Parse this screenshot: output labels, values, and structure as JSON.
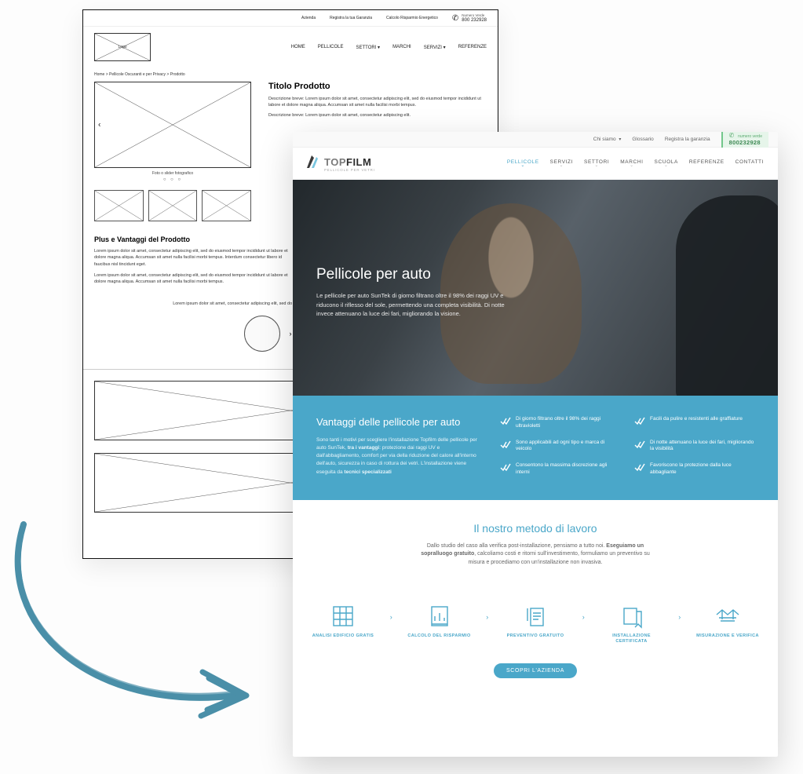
{
  "wireframe": {
    "topbar": {
      "items": [
        "Azienda",
        "Registra la tua Garanzia",
        "Calcolo Risparmio Energetico"
      ],
      "phone_label": "Numero Verde",
      "phone": "800 232928"
    },
    "logo_text": "Logo",
    "nav": [
      "HOME",
      "PELLICOLE",
      "SETTORI ▾",
      "MARCHI",
      "SERVIZI ▾",
      "REFERENZE"
    ],
    "breadcrumbs": "Home > Pellicole Oscuranti e per Privacy > Prodotto",
    "slider_caption": "Foto o slider fotografico",
    "product": {
      "title": "Titolo Prodotto",
      "p1": "Descrizione breve: Lorem ipsum dolor sit amet, consectetur adipiscing elit, sed do eiusmod tempor incididunt ut labore et dolore magna aliqua. Accumsan sit amet nulla facilisi morbi tempus.",
      "p2": "Descrizione breve: Lorem ipsum dolor sit amet, consectetur adipiscing elit."
    },
    "plus": {
      "title": "Plus e Vantaggi del Prodotto",
      "p1": "Lorem ipsum dolor sit amet, consectetur adipiscing elit, sed do eiusmod tempor incididunt ut labore et dolore magna aliqua. Accumsan sit amet nulla facilisi morbi tempus. Interdum consectetur libero id faucibus nisl tincidunt eget.",
      "p2": "Lorem ipsum dolor sit amet, consectetur adipiscing elit, sed do eiusmod tempor incididunt ut labore et dolore magna aliqua. Accumsan sit amet nulla facilisi morbi tempus."
    },
    "feelings_text": "Lorem ipsum dolor sit amet, consectetur adipiscing elit, sed do eiusmod tempor incididunt ut labore et dolore magna aliqua."
  },
  "mockup": {
    "topbar": {
      "items": [
        "Chi siamo",
        "Glossario",
        "Registra la garanzia"
      ],
      "verde_label": "numero verde",
      "verde_number": "800232928"
    },
    "logo": {
      "part1": "TOP",
      "part2": "FILM",
      "tagline": "PELLICOLE PER VETRI"
    },
    "nav": [
      {
        "label": "PELLICOLE",
        "active": true,
        "dropdown": true
      },
      {
        "label": "SERVIZI",
        "active": false,
        "dropdown": true
      },
      {
        "label": "SETTORI",
        "active": false,
        "dropdown": true
      },
      {
        "label": "MARCHI",
        "active": false,
        "dropdown": true
      },
      {
        "label": "SCUOLA",
        "active": false,
        "dropdown": true
      },
      {
        "label": "REFERENZE",
        "active": false,
        "dropdown": false
      },
      {
        "label": "CONTATTI",
        "active": false,
        "dropdown": false
      }
    ],
    "hero": {
      "title": "Pellicole per auto",
      "text": "Le pellicole per auto SunTek di giorno filtrano oltre il 98% dei raggi UV e riducono il riflesso del sole, permettendo una completa visibilità. Di notte invece attenuano la luce dei fari, migliorando la visione."
    },
    "blueband": {
      "title": "Vantaggi delle pellicole per auto",
      "text_a": "Sono tanti i motivi per scegliere l'installazione Topfilm delle pellicole per auto SunTek, ",
      "text_bold1": "tra i vantaggi",
      "text_b": ": protezione dai raggi UV e dall'abbagliamento, comfort per via della riduzione del calore all'interno dell'auto, sicurezza in caso di rottura dei vetri. L'installazione viene eseguita da ",
      "text_bold2": "tecnici specializzati",
      "advantages": [
        "Di giorno filtrano oltre il 98% dei raggi ultravioletti",
        "Facili da pulire e resistenti alle graffiature",
        "Sono applicabili ad ogni tipo e marca di veicolo",
        "Di notte attenuano la luce dei fari, migliorando la visibilità",
        "Consentono la massima discrezione agli interni",
        "Favoriscono la protezione dalla luce abbagliante"
      ]
    },
    "method": {
      "title": "Il nostro metodo di lavoro",
      "text_a": "Dallo studio del caso alla verifica post-installazione, pensiamo a tutto noi. ",
      "text_bold": "Eseguiamo un sopralluogo gratuito",
      "text_b": ", calcoliamo costi e ritorni sull'investimento, formuliamo un preventivo su misura e procediamo con un'installazione non invasiva.",
      "steps": [
        "ANALISI EDIFICIO GRATIS",
        "CALCOLO DEL RISPARMIO",
        "PREVENTIVO GRATUITO",
        "INSTALLAZIONE CERTIFICATA",
        "MISURAZIONE E VERIFICA"
      ],
      "cta": "SCOPRI L'AZIENDA"
    }
  }
}
